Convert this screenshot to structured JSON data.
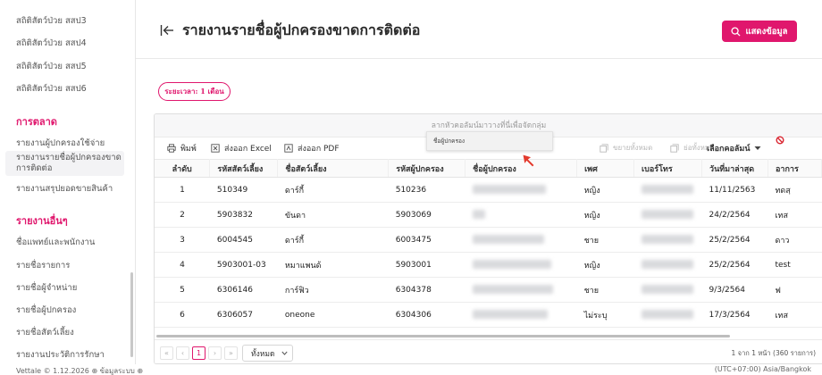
{
  "sidebar": {
    "items_top": [
      "สถิติสัตว์ป่วย สสป3",
      "สถิติสัตว์ป่วย สสป4",
      "สถิติสัตว์ป่วย สสป5",
      "สถิติสัตว์ป่วย สสป6"
    ],
    "section_marketing": "การตลาด",
    "marketing_items": [
      "รายงานผู้ปกครองใช้จ่าย",
      "รายงานรายชื่อผู้ปกครองขาดการติดต่อ",
      "รายงานสรุปยอดขายสินค้า"
    ],
    "section_other": "รายงานอื่นๆ",
    "other_items": [
      "ชื่อแพทย์และพนักงาน",
      "รายชื่อรายการ",
      "รายชื่อผู้จำหน่าย",
      "รายชื่อผู้ปกครอง",
      "รายชื่อสัตว์เลี้ยง",
      "รายงานประวัติการรักษา"
    ]
  },
  "header": {
    "title": "รายงานรายชื่อผู้ปกครองขาดการติดต่อ",
    "show_button": "แสดงข้อมูล"
  },
  "period_badge": "ระยะเวลา: 1 เดือน",
  "grid": {
    "group_hint": "ลากหัวคอลัมน์มาวางที่นี่เพื่อจัดกลุ่ม",
    "drag_chip": "ชื่อผู้ปกครอง",
    "toolbar": {
      "print": "พิมพ์",
      "export_excel": "ส่งออก Excel",
      "export_pdf": "ส่งออก PDF",
      "expand_all": "ขยายทั้งหมด",
      "collapse_all": "ย่อทั้งหมด",
      "choose_columns": "เลือกคอลัมน์"
    },
    "columns": [
      "ลำดับ",
      "รหัสสัตว์เลี้ยง",
      "ชื่อสัตว์เลี้ยง",
      "รหัสผู้ปกครอง",
      "ชื่อผู้ปกครอง",
      "เพศ",
      "เบอร์โทร",
      "วันที่มาล่าสุด",
      "อาการ"
    ],
    "rows": [
      {
        "no": "1",
        "pet_code": "510349",
        "pet_name": "ดาร์กี้",
        "owner_code": "510236",
        "sex": "หญิง",
        "last_visit": "11/11/2563",
        "symptom": "ทดสฺ"
      },
      {
        "no": "2",
        "pet_code": "5903832",
        "pet_name": "ขันดา",
        "owner_code": "5903069",
        "sex": "หญิง",
        "last_visit": "24/2/2564",
        "symptom": "เทส"
      },
      {
        "no": "3",
        "pet_code": "6004545",
        "pet_name": "ดาร์กี้",
        "owner_code": "6003475",
        "sex": "ชาย",
        "last_visit": "25/2/2564",
        "symptom": "ดาว"
      },
      {
        "no": "4",
        "pet_code": "5903001-03",
        "pet_name": "หมาแพนด้",
        "owner_code": "5903001",
        "sex": "หญิง",
        "last_visit": "25/2/2564",
        "symptom": "test"
      },
      {
        "no": "5",
        "pet_code": "6306146",
        "pet_name": "การ์ฟิว",
        "owner_code": "6304378",
        "sex": "ชาย",
        "last_visit": "9/3/2564",
        "symptom": "ฟ"
      },
      {
        "no": "6",
        "pet_code": "6306057",
        "pet_name": "oneone",
        "owner_code": "6304306",
        "sex": "ไม่ระบุ",
        "last_visit": "17/3/2564",
        "symptom": "เทส"
      }
    ],
    "pager": {
      "current_page": "1",
      "page_size": "ทั้งหมด",
      "info": "1 จาก 1 หน้า (360 รายการ)"
    }
  },
  "footer": {
    "left": "Vettale © 1.12.2026   ⊕ ข้อมูลระบบ ⊕",
    "right": "(UTC+07:00) Asia/Bangkok"
  },
  "colors": {
    "accent": "#e0176d"
  }
}
